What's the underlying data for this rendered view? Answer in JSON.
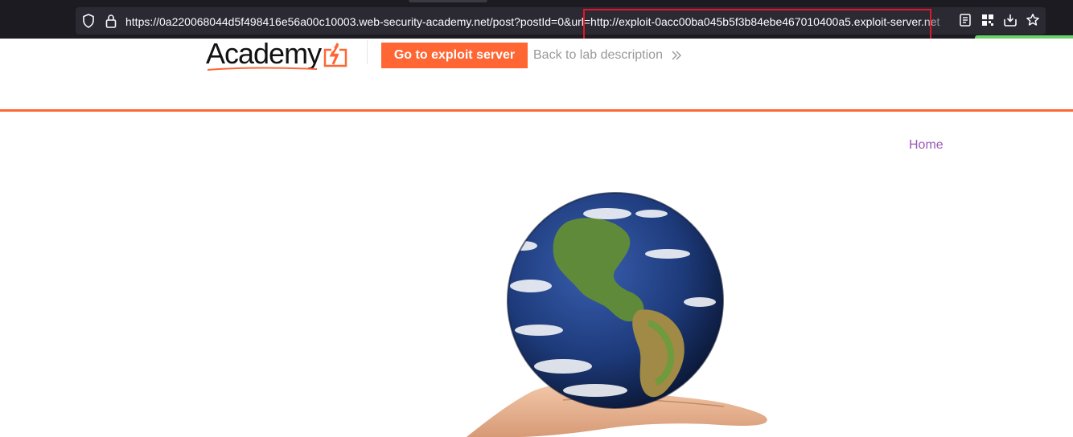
{
  "browser": {
    "url": "https://0a220068044d5f498416e56a00c10003.web-security-academy.net/post?postId=0&url=http://exploit-0acc00ba045b5f3b84ebe467010400a5.exploit-server.net"
  },
  "header": {
    "logo_text": "Academy",
    "exploit_button_label": "Go to exploit server",
    "back_link_label": "Back to lab description"
  },
  "nav": {
    "home_label": "Home"
  },
  "colors": {
    "accent": "#ff6633",
    "highlight": "#e0162b",
    "link": "#9b59b6"
  },
  "icons": {
    "shield": "shield-icon",
    "lock": "lock-icon",
    "reader": "reader-view-icon",
    "qr": "qr-code-icon",
    "pocket": "save-to-pocket-icon",
    "star": "bookmark-star-icon"
  }
}
